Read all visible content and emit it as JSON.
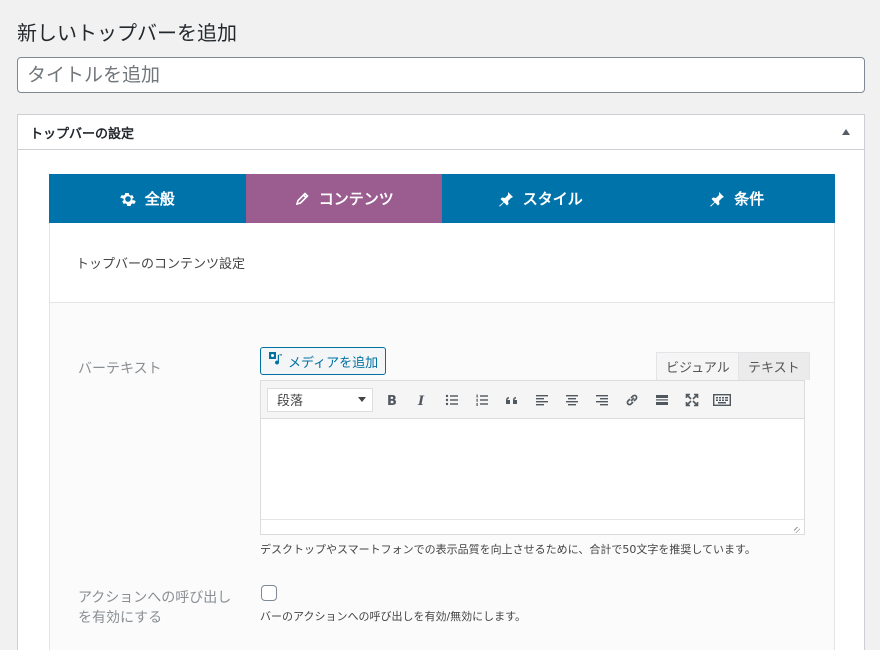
{
  "page": {
    "title": "新しいトップバーを追加",
    "title_placeholder": "タイトルを追加"
  },
  "metabox": {
    "title": "トップバーの設定",
    "toggle_icon": "triangle-up-icon"
  },
  "tabs": [
    {
      "label": "全般",
      "icon": "gear-icon"
    },
    {
      "label": "コンテンツ",
      "icon": "pencil-icon",
      "active": true
    },
    {
      "label": "スタイル",
      "icon": "pin-icon"
    },
    {
      "label": "条件",
      "icon": "pin-icon"
    }
  ],
  "panel": {
    "heading": "トップバーのコンテンツ設定"
  },
  "fields": {
    "bar_text": {
      "label": "バーテキスト",
      "media_button": "メディアを追加",
      "mode_visual": "ビジュアル",
      "mode_text": "テキスト",
      "format_select": "段落",
      "help": "デスクトップやスマートフォンでの表示品質を向上させるために、合計で50文字を推奨しています。"
    },
    "cta": {
      "label_line1": "アクションへの呼び出し",
      "label_line2": "を有効にする",
      "help": "バーのアクションへの呼び出しを有効/無効にします。",
      "checked": false
    }
  },
  "colors": {
    "tab_blue": "#0073aa",
    "tab_active": "#9b5c8f"
  }
}
